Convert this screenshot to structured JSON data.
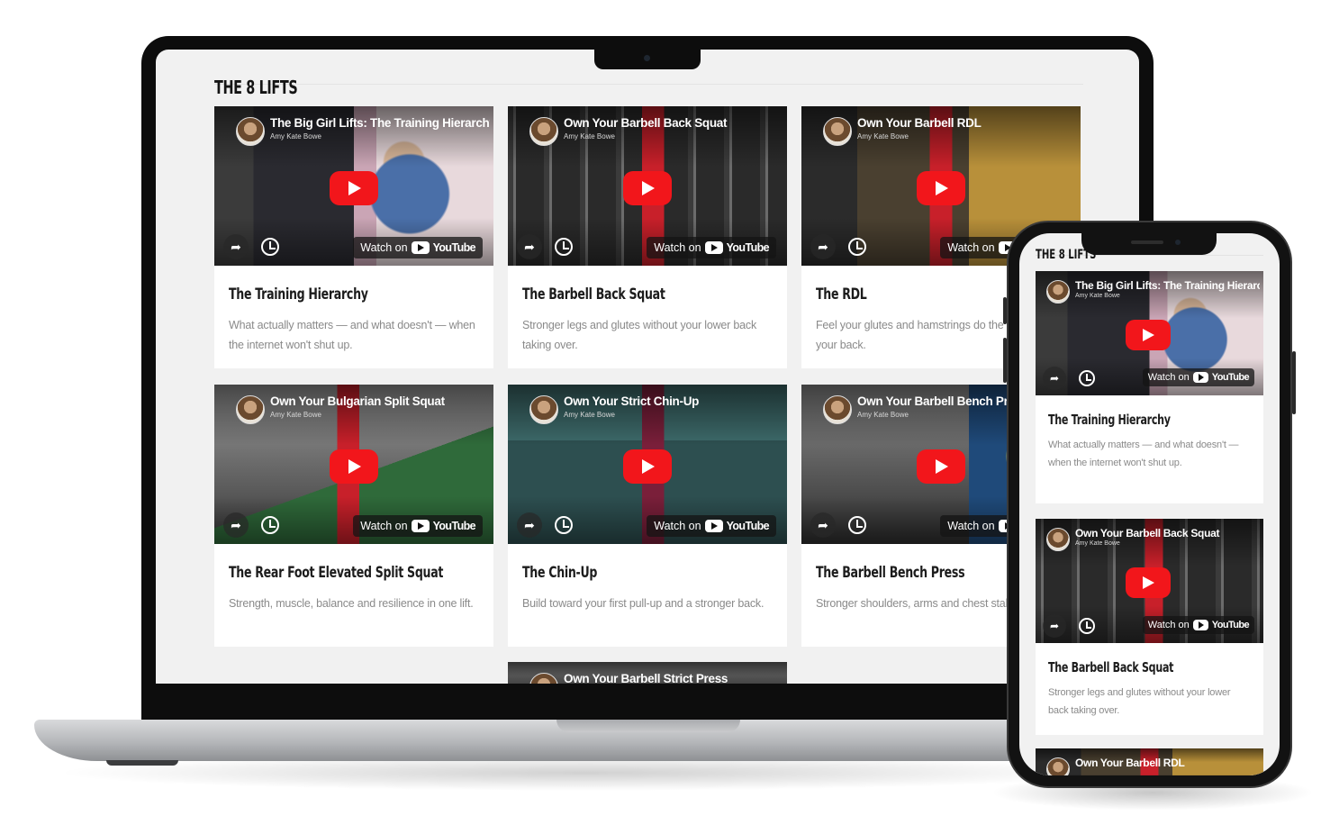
{
  "section": {
    "title": "THE 8 LIFTS"
  },
  "player": {
    "channel": "Amy Kate Bowe",
    "watch_on": "Watch on",
    "youtube": "YouTube"
  },
  "cards": [
    {
      "video_title": "The Big Girl Lifts: The Training Hierarchy",
      "title": "The Training Hierarchy",
      "description": "What actually matters — and what doesn't — when the internet won't shut up."
    },
    {
      "video_title": "Own Your Barbell Back Squat",
      "title": "The Barbell Back Squat",
      "description": "Stronger legs and glutes without your lower back taking over."
    },
    {
      "video_title": "Own Your Barbell RDL",
      "title": "The RDL",
      "description": "Feel your glutes and hamstrings do the work, not your back."
    },
    {
      "video_title": "Own Your Bulgarian Split Squat",
      "title": "The Rear Foot Elevated Split Squat",
      "description": "Strength, muscle, balance and resilience in one lift."
    },
    {
      "video_title": "Own Your Strict Chin-Up",
      "title": "The Chin-Up",
      "description": "Build toward your first pull-up and a stronger back."
    },
    {
      "video_title": "Own Your Barbell Bench Press",
      "title": "The Barbell Bench Press",
      "description": "Stronger shoulders, arms and chest stability."
    },
    {
      "video_title": "Own Your Barbell Strict Press"
    }
  ],
  "colors": {
    "accent": "#f2161b",
    "page_bg": "#f1f1f1",
    "card_bg": "#ffffff",
    "text": "#1c1c1c",
    "muted": "#8a8a8a"
  }
}
